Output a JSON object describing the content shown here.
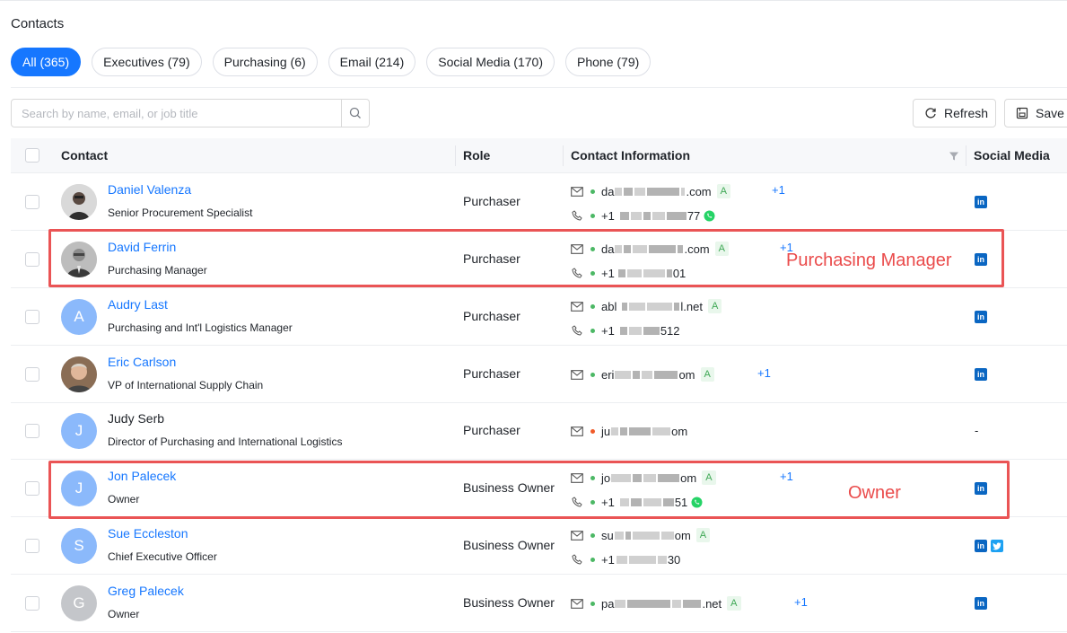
{
  "page": {
    "title": "Contacts"
  },
  "tabs": [
    {
      "label": "All (365)",
      "active": true
    },
    {
      "label": "Executives (79)",
      "active": false
    },
    {
      "label": "Purchasing (6)",
      "active": false
    },
    {
      "label": "Email (214)",
      "active": false
    },
    {
      "label": "Social Media (170)",
      "active": false
    },
    {
      "label": "Phone (79)",
      "active": false
    }
  ],
  "search": {
    "placeholder": "Search by name, email, or job title"
  },
  "toolbar": {
    "refresh_label": "Refresh",
    "save_label": "Save C"
  },
  "table": {
    "headers": {
      "contact": "Contact",
      "role": "Role",
      "contact_info": "Contact Information",
      "social": "Social Media"
    },
    "rows": [
      {
        "name": "Daniel Valenza",
        "title": "Senior Procurement Specialist",
        "role": "Purchaser",
        "email": "da",
        "email_end": ".com",
        "phone": "+1",
        "phone_end": "77",
        "plus": "+1"
      },
      {
        "name": "David Ferrin",
        "title": "Purchasing Manager",
        "role": "Purchaser",
        "email": "da",
        "email_end": ".com",
        "phone": "+1",
        "phone_end": "01",
        "plus": "+1"
      },
      {
        "name": "Audry Last",
        "initial": "A",
        "title": "Purchasing and Int'l Logistics Manager",
        "role": "Purchaser",
        "email": "abl",
        "email_end": "l.net",
        "phone": "+1",
        "phone_end": "512"
      },
      {
        "name": "Eric Carlson",
        "title": "VP of International Supply Chain",
        "role": "Purchaser",
        "email": "eri",
        "email_end": "om",
        "plus": "+1"
      },
      {
        "name": "Judy Serb",
        "initial": "J",
        "title": "Director of Purchasing and International Logistics",
        "role": "Purchaser",
        "email": "ju",
        "email_end": "om",
        "social_empty": "-"
      },
      {
        "name": "Jon Palecek",
        "initial": "J",
        "title": "Owner",
        "role": "Business Owner",
        "email": "jo",
        "email_end": "om",
        "phone": "+1",
        "phone_end": "51",
        "plus": "+1"
      },
      {
        "name": "Sue Eccleston",
        "initial": "S",
        "title": "Chief Executive Officer",
        "role": "Business Owner",
        "email": "su",
        "email_end": "om",
        "phone": "+1",
        "phone_end": "30"
      },
      {
        "name": "Greg Palecek",
        "initial": "G",
        "title": "Owner",
        "role": "Business Owner",
        "email": "pa",
        "email_end": ".net",
        "plus": "+1"
      }
    ]
  },
  "badge": {
    "a": "A"
  },
  "social": {
    "linkedin": "in"
  },
  "annotations": {
    "purchasing_manager": "Purchasing Manager",
    "owner": "Owner"
  },
  "colors": {
    "accent": "#1677ff",
    "highlight": "#ea5455",
    "status_green": "#4cb865",
    "status_red": "#f05a28"
  }
}
